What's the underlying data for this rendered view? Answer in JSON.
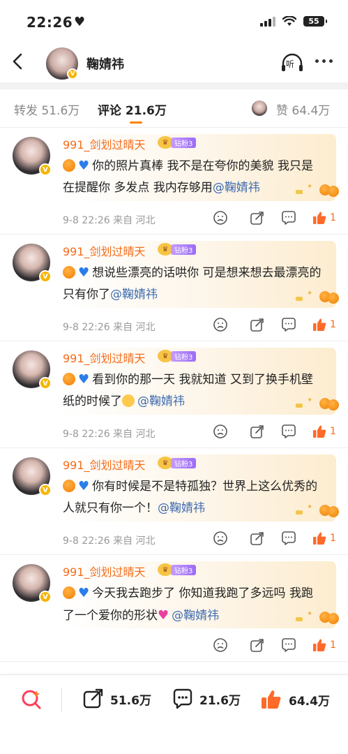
{
  "status_bar": {
    "time": "22:26",
    "heart": "♥",
    "battery": "55"
  },
  "nav": {
    "title": "鞠婧祎",
    "listen_label": "听"
  },
  "tabs": {
    "repost": "转发 51.6万",
    "comments": "评论 21.6万",
    "likes": "赞 64.4万"
  },
  "comments": [
    {
      "user": "991_剑划过晴天",
      "fan_level": "钻粉3",
      "text": "你的照片真棒 我不是在夸你的美貌 我只是在提醒你 多发点 我内存够用",
      "mention": "@鞠婧祎",
      "trailing_emoji": "",
      "meta": "9-8 22:26 来自 河北",
      "likes": "1"
    },
    {
      "user": "991_剑划过晴天",
      "fan_level": "钻粉3",
      "text": "想说些漂亮的话哄你 可是想来想去最漂亮的只有你了",
      "mention": "@鞠婧祎",
      "trailing_emoji": "",
      "meta": "9-8 22:26 来自 河北",
      "likes": "1"
    },
    {
      "user": "991_剑划过晴天",
      "fan_level": "钻粉3",
      "text": "看到你的那一天 我就知道 又到了换手机壁纸的时候了",
      "mention": "@鞠婧祎",
      "trailing_emoji": "kiss",
      "meta": "9-8 22:26 来自 河北",
      "likes": "1"
    },
    {
      "user": "991_剑划过晴天",
      "fan_level": "钻粉3",
      "text": "你有时候是不是特孤独？世界上这么优秀的人就只有你一个！",
      "mention": "@鞠婧祎",
      "trailing_emoji": "",
      "meta": "9-8 22:26 来自 河北",
      "likes": "1"
    },
    {
      "user": "991_剑划过晴天",
      "fan_level": "钻粉3",
      "text": "今天我去跑步了 你知道我跑了多远吗 我跑了一个爱你的形状",
      "mention": "@鞠婧祎",
      "trailing_emoji": "pink-heart",
      "meta": "",
      "likes": "1"
    }
  ],
  "bottom_bar": {
    "repost_count": "51.6万",
    "comment_count": "21.6万",
    "like_count": "64.4万"
  },
  "colors": {
    "accent": "#f56c1a",
    "mention": "#3f6bb0",
    "tab_underline": "#ff8200"
  }
}
